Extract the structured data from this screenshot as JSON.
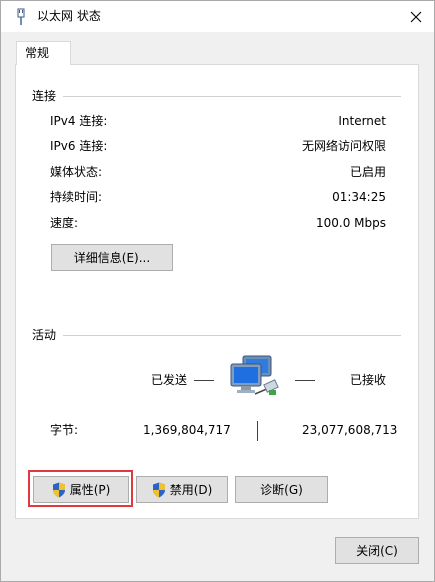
{
  "window": {
    "title": "以太网 状态"
  },
  "tabs": [
    {
      "label": "常规"
    }
  ],
  "connection": {
    "label": "连接",
    "rows": [
      {
        "label": "IPv4 连接:",
        "value": "Internet"
      },
      {
        "label": "IPv6 连接:",
        "value": "无网络访问权限"
      },
      {
        "label": "媒体状态:",
        "value": "已启用"
      },
      {
        "label": "持续时间:",
        "value": "01:34:25"
      },
      {
        "label": "速度:",
        "value": "100.0 Mbps"
      }
    ],
    "details_button": "详细信息(E)..."
  },
  "activity": {
    "label": "活动",
    "sent_label": "已发送",
    "received_label": "已接收",
    "bytes_label": "字节:",
    "bytes_sent": "1,369,804,717",
    "bytes_received": "23,077,608,713"
  },
  "actions": {
    "properties": "属性(P)",
    "disable": "禁用(D)",
    "diagnose": "诊断(G)"
  },
  "footer": {
    "close": "关闭(C)"
  },
  "colors": {
    "highlight": "#e0393e",
    "shield_blue": "#2b63c6",
    "shield_yellow": "#f2c12e"
  }
}
